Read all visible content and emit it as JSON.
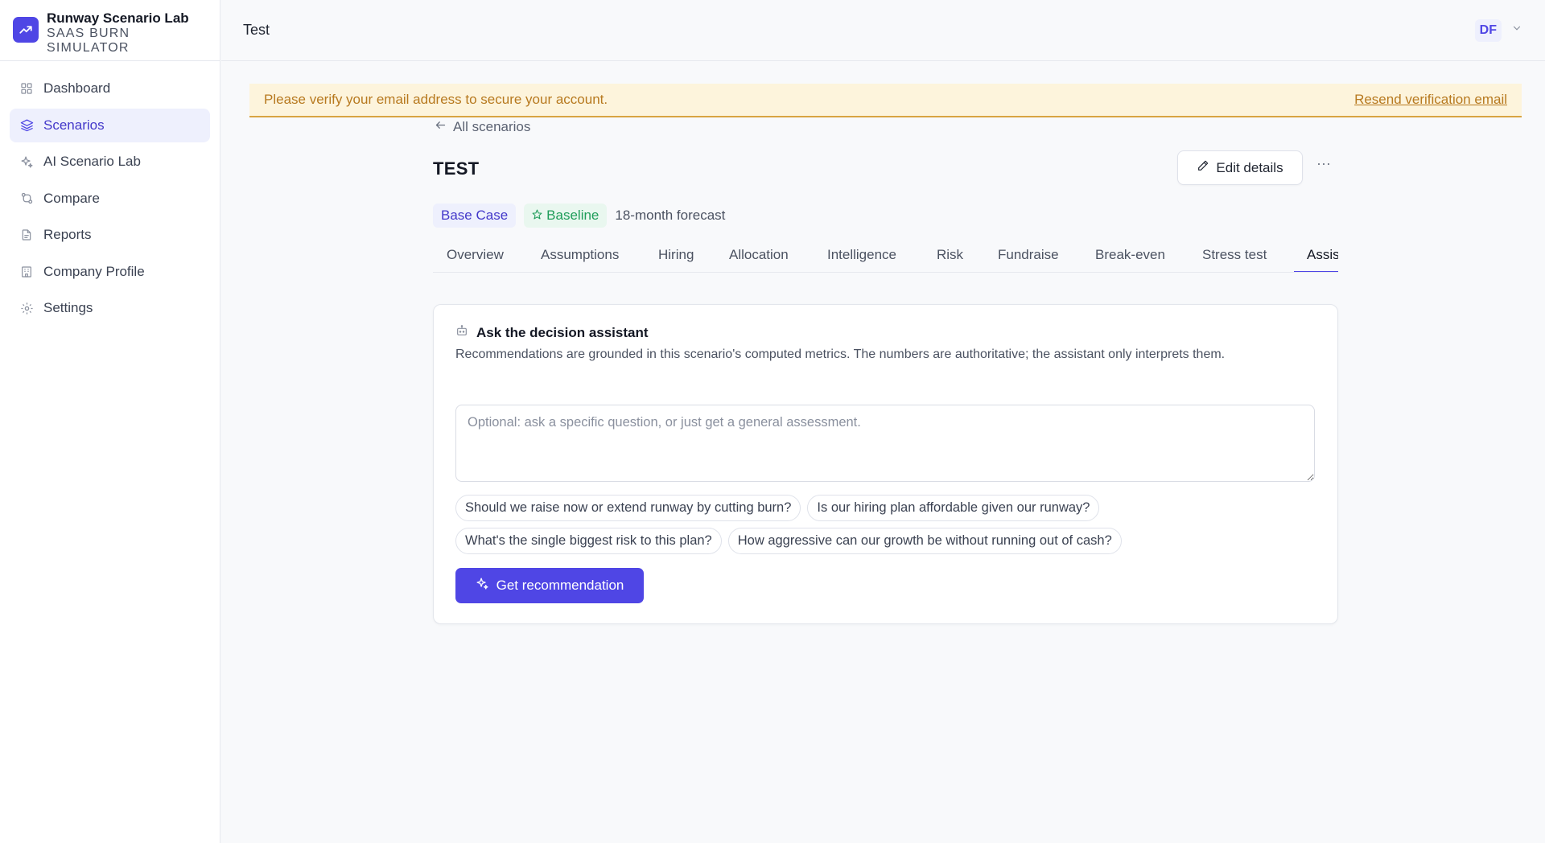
{
  "brand": {
    "title": "Runway Scenario Lab",
    "subtitle_line1": "SAAS BURN",
    "subtitle_line2": "SIMULATOR"
  },
  "nav": {
    "items": [
      {
        "label": "Dashboard",
        "icon": "grid-icon",
        "active": false
      },
      {
        "label": "Scenarios",
        "icon": "layers-icon",
        "active": true
      },
      {
        "label": "AI Scenario Lab",
        "icon": "sparkles-icon",
        "active": false
      },
      {
        "label": "Compare",
        "icon": "compare-icon",
        "active": false
      },
      {
        "label": "Reports",
        "icon": "document-icon",
        "active": false
      },
      {
        "label": "Company Profile",
        "icon": "building-icon",
        "active": false
      },
      {
        "label": "Settings",
        "icon": "gear-icon",
        "active": false
      }
    ]
  },
  "topbar": {
    "title": "Test",
    "user_initials": "DF"
  },
  "banner": {
    "message": "Please verify your email address to secure your account.",
    "link": "Resend verification email"
  },
  "scenario": {
    "back_label": "All scenarios",
    "title": "TEST",
    "edit_label": "Edit details",
    "more_label": "···",
    "badge_case": "Base Case",
    "badge_baseline": "Baseline",
    "forecast": "18-month forecast"
  },
  "tabs": [
    {
      "label": "Overview",
      "active": false
    },
    {
      "label": "Assumptions",
      "active": false
    },
    {
      "label": "Hiring",
      "active": false
    },
    {
      "label": "Allocation",
      "active": false
    },
    {
      "label": "Intelligence",
      "active": false
    },
    {
      "label": "Risk",
      "active": false
    },
    {
      "label": "Fundraise",
      "active": false
    },
    {
      "label": "Break-even",
      "active": false
    },
    {
      "label": "Stress test",
      "active": false
    },
    {
      "label": "Assistant",
      "active": true
    }
  ],
  "assistant": {
    "title": "Ask the decision assistant",
    "description": "Recommendations are grounded in this scenario's computed metrics. The numbers are authoritative; the assistant only interprets them.",
    "input_value": "",
    "input_placeholder": "Optional: ask a specific question, or just get a general assessment.",
    "suggestions": [
      "Should we raise now or extend runway by cutting burn?",
      "Is our hiring plan affordable given our runway?",
      "What's the single biggest risk to this plan?",
      "How aggressive can our growth be without running out of cash?"
    ],
    "button_label": "Get recommendation"
  },
  "colors": {
    "accent": "#4f46e5",
    "banner_bg": "#fdf4dc",
    "banner_text": "#b7791f",
    "baseline_green": "#1f9d5a"
  }
}
